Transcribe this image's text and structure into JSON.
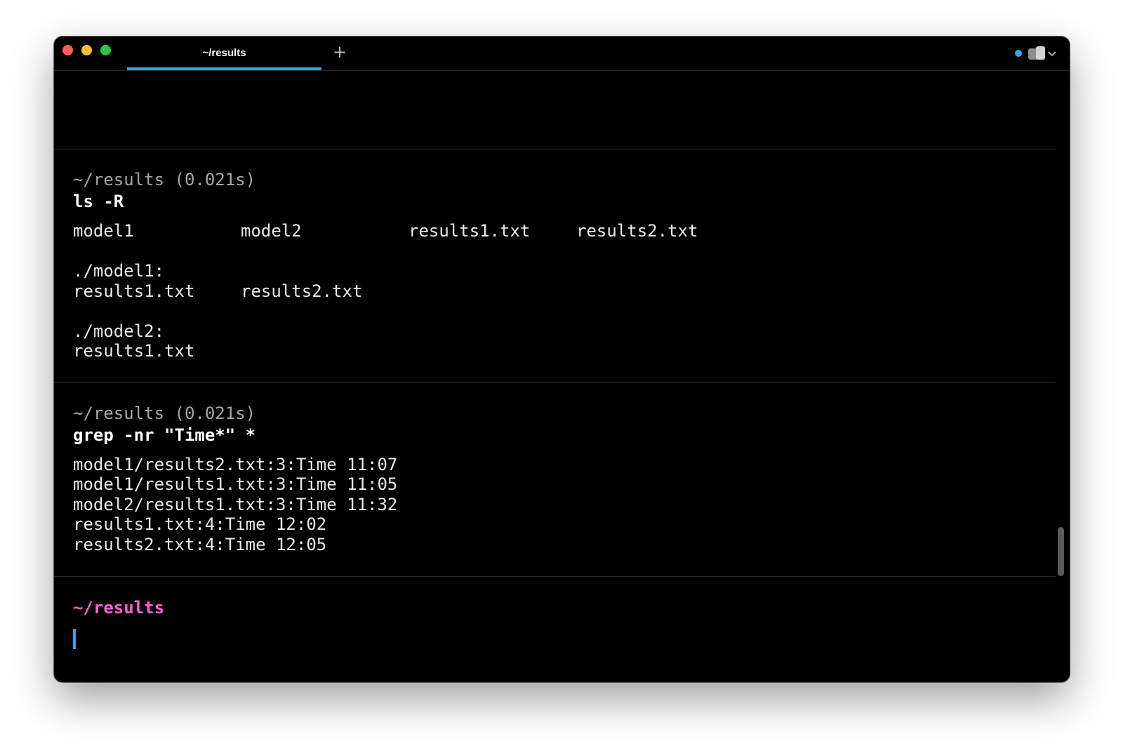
{
  "tab": {
    "title": "~/results",
    "new_tab_symbol": "+"
  },
  "colors": {
    "accent": "#2aa7f0",
    "prompt": "#ff5ed8"
  },
  "icons": {
    "status": "status-dot-icon",
    "panel_toggle": "panel-toggle-icon",
    "menu": "chevron-down-icon"
  },
  "blocks": [
    {
      "meta": "~/results (0.021s)",
      "command": "ls -R",
      "ls_row": [
        "model1",
        "model2",
        "results1.txt",
        "results2.txt"
      ],
      "dir1_header": "./model1:",
      "dir1_files": [
        "results1.txt",
        "results2.txt"
      ],
      "dir2_header": "./model2:",
      "dir2_files": [
        "results1.txt"
      ]
    },
    {
      "meta": "~/results (0.021s)",
      "command": "grep -nr \"Time*\" *",
      "output": [
        "model1/results2.txt:3:Time 11:07",
        "model1/results1.txt:3:Time 11:05",
        "model2/results1.txt:3:Time 11:32",
        "results1.txt:4:Time 12:02",
        "results2.txt:4:Time 12:05"
      ]
    }
  ],
  "prompt": {
    "path": "~/results"
  }
}
